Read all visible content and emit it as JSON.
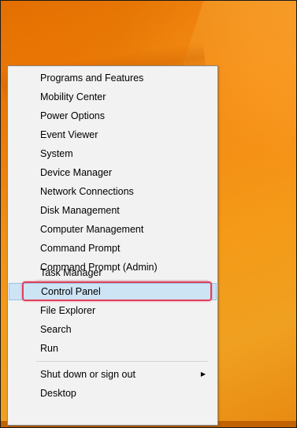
{
  "context_menu": {
    "items": [
      {
        "id": "programs-and-features",
        "label": "Programs and Features"
      },
      {
        "id": "mobility-center",
        "label": "Mobility Center"
      },
      {
        "id": "power-options",
        "label": "Power Options"
      },
      {
        "id": "event-viewer",
        "label": "Event Viewer"
      },
      {
        "id": "system",
        "label": "System"
      },
      {
        "id": "device-manager",
        "label": "Device Manager"
      },
      {
        "id": "network-connections",
        "label": "Network Connections"
      },
      {
        "id": "disk-management",
        "label": "Disk Management"
      },
      {
        "id": "computer-management",
        "label": "Computer Management"
      },
      {
        "id": "command-prompt",
        "label": "Command Prompt"
      },
      {
        "id": "command-prompt-admin",
        "label": "Command Prompt (Admin)"
      },
      {
        "id": "task-manager",
        "label": "Task Manager"
      },
      {
        "id": "control-panel",
        "label": "Control Panel",
        "selected": true
      },
      {
        "id": "file-explorer",
        "label": "File Explorer"
      },
      {
        "id": "search",
        "label": "Search"
      },
      {
        "id": "run",
        "label": "Run"
      },
      {
        "id": "shut-down-or-sign-out",
        "label": "Shut down or sign out",
        "has_submenu": true
      },
      {
        "id": "desktop",
        "label": "Desktop"
      }
    ],
    "submenu_arrow_icon": "triangle-right-icon"
  },
  "colors": {
    "desktop_accent": "#f08a10",
    "menu_background": "#f2f2f2",
    "selected_background": "#cde4f5",
    "highlight_ring": "#e0405a"
  }
}
